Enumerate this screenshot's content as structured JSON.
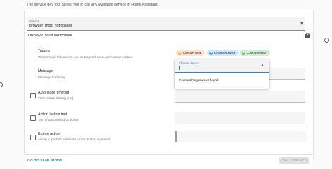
{
  "intro_text": "The service dev tool allows you to call any available service in Home Assistant.",
  "service_field": {
    "label": "Service",
    "value": "browser_mod: notification"
  },
  "service_description": "Display a short notification",
  "help_icon_text": "?",
  "targets": {
    "label": "Targets",
    "sublabel": "What should this service use as targeted areas, devices or entities.",
    "chips": [
      {
        "label": "Choose area",
        "color": "#f4a261",
        "bg": "#fde3cf"
      },
      {
        "label": "Choose device",
        "color": "#42a5f5",
        "bg": "#cfe6fb"
      },
      {
        "label": "Choose entity",
        "color": "#66bb6a",
        "bg": "#d4edd6"
      }
    ]
  },
  "device_dropdown": {
    "label": "Choose device",
    "empty_text": "No matching devices found"
  },
  "message": {
    "label": "Message",
    "sublabel": "Message to display"
  },
  "auto_close": {
    "label": "Auto close timeout",
    "sublabel": "Time before closing (ms)"
  },
  "action_text": {
    "label": "Action button text",
    "sublabel": "Text of optional action button"
  },
  "button_action": {
    "label": "Button action",
    "sublabel": "Action to perform when the action button is pressed"
  },
  "footer": {
    "yaml_button": "GO TO YAML MODE",
    "call_button": "CALL SERVICE"
  }
}
